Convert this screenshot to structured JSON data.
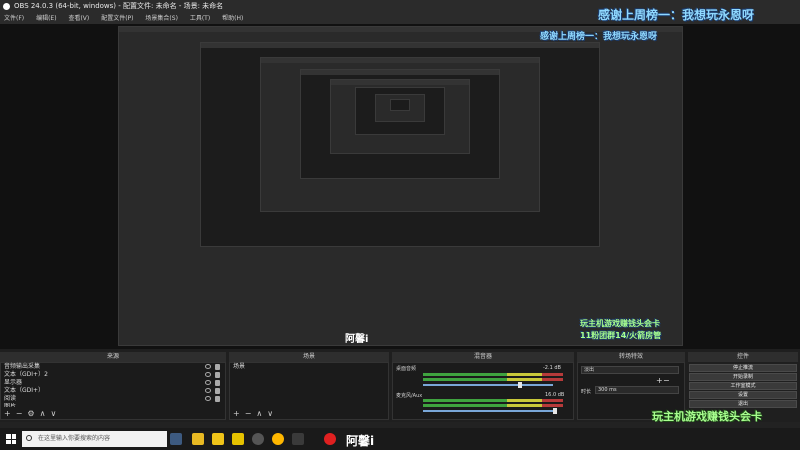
{
  "window": {
    "title": "OBS 24.0.3 (64-bit, windows) - 配置文件: 未命名 - 场景: 未命名"
  },
  "menubar": {
    "items": [
      "文件(F)",
      "编辑(E)",
      "查看(V)",
      "配置文件(P)",
      "场景集合(S)",
      "工具(T)",
      "帮助(H)"
    ]
  },
  "overlay": {
    "top_text": "感谢上周榜一：我想玩永恩呀",
    "ad_line1": "玩主机游戏赚钱头会卡",
    "ad_line2": "11粉团群14/火箭房管",
    "brand": "阿馨i"
  },
  "docks": {
    "sources_title": "来源",
    "scenes_title": "场景",
    "mixer_title": "混音器",
    "transitions_title": "转场特效",
    "controls_title": "控件"
  },
  "sources": {
    "items": [
      "音频输出采集",
      "文本（GDI+）2",
      "显示器",
      "文本（GDI+）",
      "阅读",
      "图片"
    ]
  },
  "scenes": {
    "items": [
      "场景"
    ]
  },
  "mixer": {
    "ch1_name": "桌面音频",
    "ch1_db": "-2.1 dB",
    "ch2_name": "麦克风/Aux",
    "ch2_db": "16.0 dB"
  },
  "transitions": {
    "selected": "淡出",
    "duration_label": "时长",
    "duration_value": "300 ms"
  },
  "controls": {
    "buttons": [
      "停止推流",
      "开始录制",
      "工作室模式",
      "设置",
      "退出"
    ]
  },
  "taskbar": {
    "search_placeholder": "在这里输入你要搜索的内容"
  },
  "toolbar_symbols": {
    "add": "+",
    "remove": "−",
    "settings": "⚙",
    "up": "∧",
    "down": "∨"
  }
}
